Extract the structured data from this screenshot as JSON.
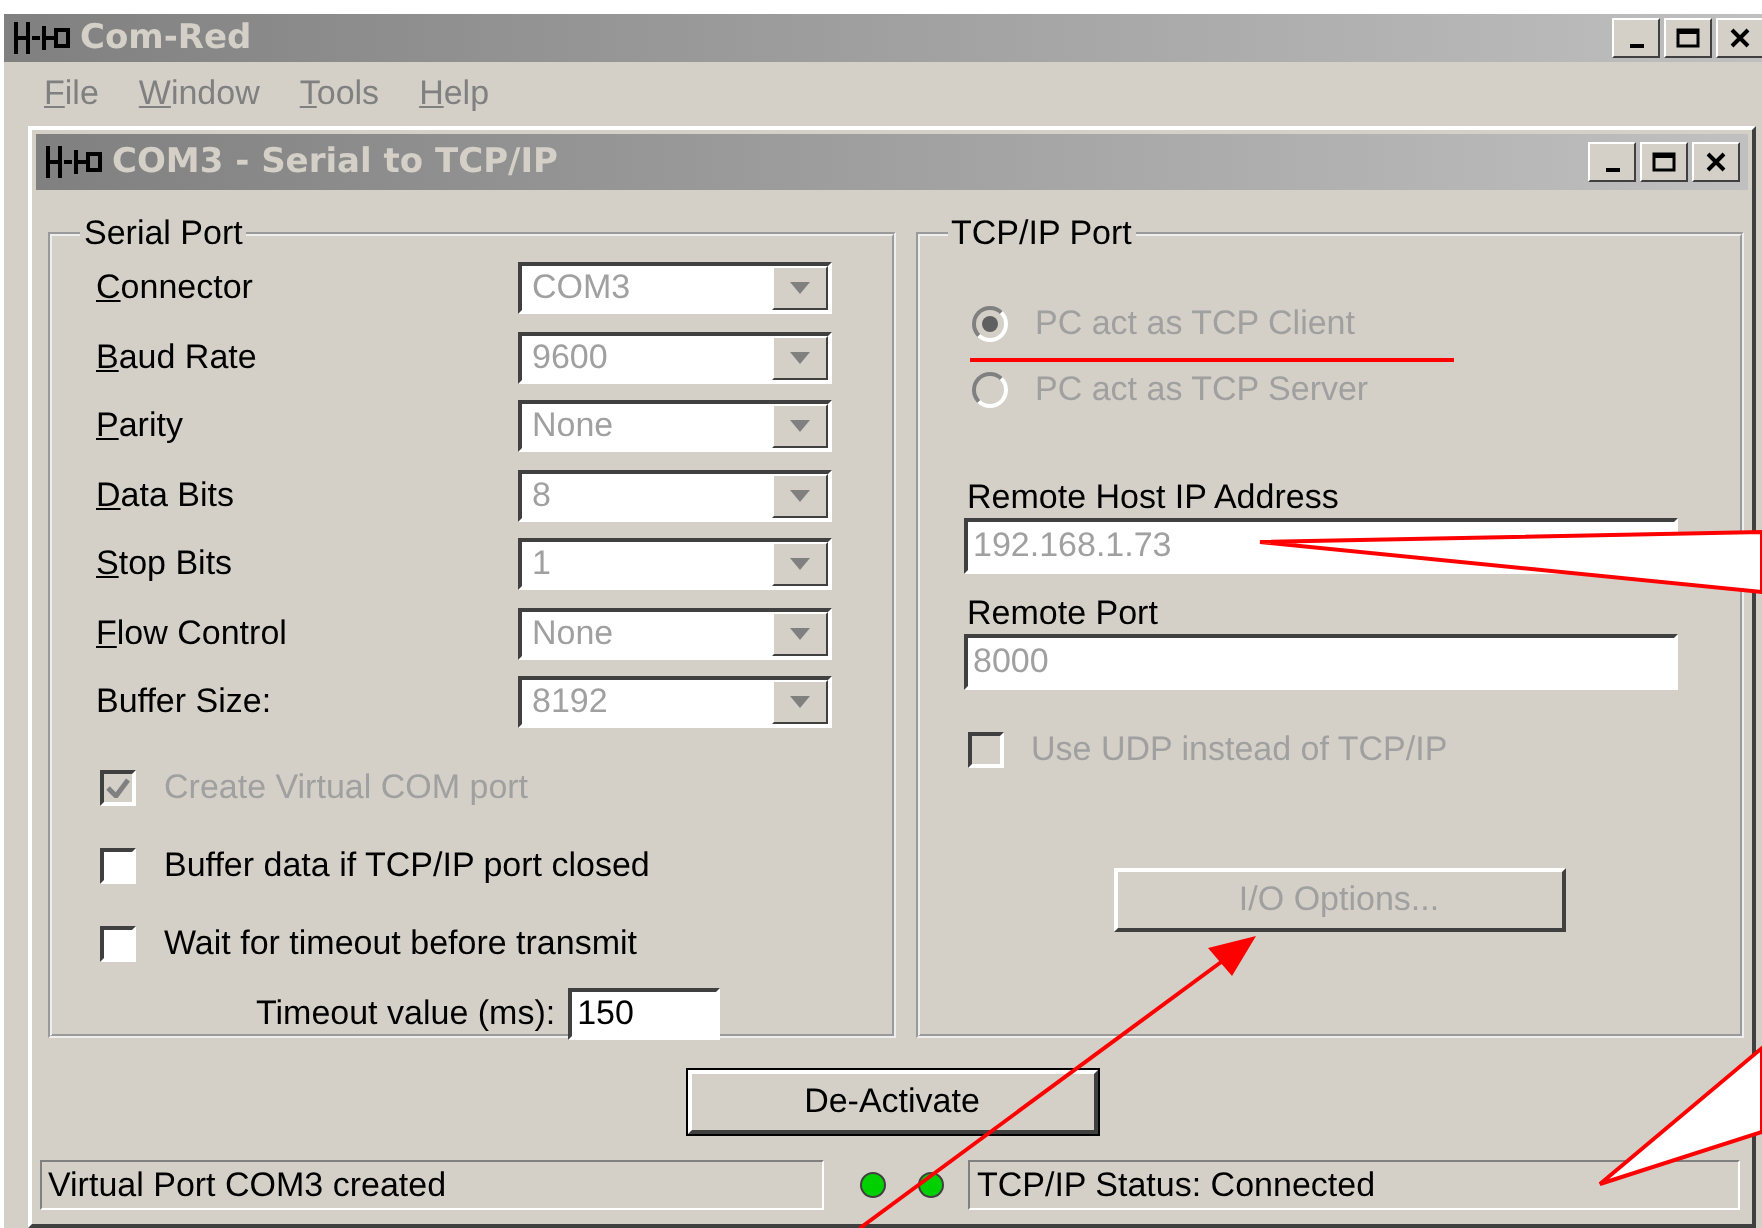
{
  "app": {
    "title": "Com-Red"
  },
  "menu": [
    {
      "label": "File",
      "mnemonic": true
    },
    {
      "label": "Window",
      "mnemonic": true
    },
    {
      "label": "Tools",
      "mnemonic": true
    },
    {
      "label": "Help",
      "mnemonic": true
    }
  ],
  "child_window": {
    "title": "COM3 - Serial to TCP/IP"
  },
  "serial_port": {
    "title": "Serial Port",
    "fields": [
      {
        "label": "Connector",
        "mnemonic": true,
        "value": "COM3",
        "disabled": true
      },
      {
        "label": "Baud Rate",
        "mnemonic": true,
        "value": "9600",
        "disabled": true
      },
      {
        "label": "Parity",
        "mnemonic": true,
        "value": "None",
        "disabled": true
      },
      {
        "label": "Data Bits",
        "mnemonic": true,
        "value": "8",
        "disabled": true
      },
      {
        "label": "Stop Bits",
        "mnemonic": true,
        "value": "1",
        "disabled": true
      },
      {
        "label": "Flow Control",
        "mnemonic": true,
        "value": "None",
        "disabled": true
      },
      {
        "label": "Buffer Size:",
        "mnemonic": false,
        "value": "8192",
        "disabled": true
      }
    ],
    "checkboxes": [
      {
        "label": "Create Virtual COM port",
        "checked": true,
        "disabled": true
      },
      {
        "label": "Buffer data if TCP/IP port closed",
        "checked": false,
        "disabled": false
      },
      {
        "label": "Wait for timeout before transmit",
        "checked": false,
        "disabled": false
      }
    ],
    "timeout": {
      "label": "Timeout value (ms):",
      "value": "150"
    }
  },
  "tcp_port": {
    "title": "TCP/IP Port",
    "radios": [
      {
        "label": "PC act as TCP Client",
        "selected": true,
        "disabled": true
      },
      {
        "label": "PC act as TCP Server",
        "selected": false,
        "disabled": true
      }
    ],
    "host": {
      "label": "Remote Host IP Address",
      "value": "192.168.1.73"
    },
    "port": {
      "label": "Remote Port",
      "value": "8000"
    },
    "udp": {
      "label": "Use UDP instead of TCP/IP",
      "checked": false,
      "disabled": true
    },
    "io_button": {
      "label": "I/O Options...",
      "disabled": true
    }
  },
  "deactivate_button": {
    "label": "De-Activate"
  },
  "status_bar": {
    "message": "Virtual Port COM3 created",
    "leds": [
      {
        "color": "#00d000"
      },
      {
        "color": "#00d000"
      }
    ],
    "status": "TCP/IP Status: Connected"
  }
}
